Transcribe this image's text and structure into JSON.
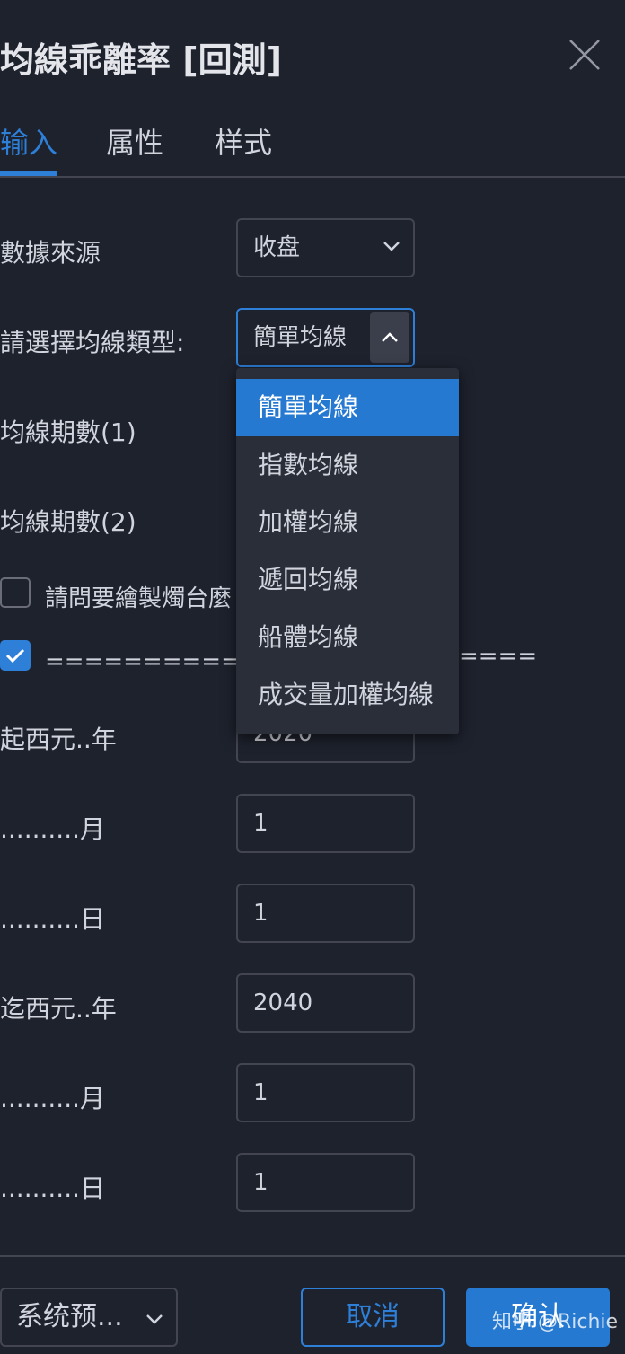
{
  "dialog": {
    "title": "均線乖離率 [回測]"
  },
  "tabs": [
    {
      "label": "输入"
    },
    {
      "label": "属性"
    },
    {
      "label": "样式"
    }
  ],
  "inputs": {
    "source_label": "數據來源",
    "source_value": "收盘",
    "ma_type_label": "請選擇均線類型:",
    "ma_type_value": "簡單均線",
    "period1_label": "均線期數(1)",
    "period2_label": "均線期數(2)",
    "draw_checkbox_label": "請問要繪製燭台麼",
    "filter_checkbox_label": "===========過濾",
    "filter_checkbox_label_tail": "====",
    "start_year_label": "起西元..年",
    "start_year_value": "2020",
    "start_month_label": "..........月",
    "start_month_value": "1",
    "start_day_label": "..........日",
    "start_day_value": "1",
    "end_year_label": "迄西元..年",
    "end_year_value": "2040",
    "end_month_label": "..........月",
    "end_month_value": "1",
    "end_day_label": "..........日",
    "end_day_value": "1"
  },
  "checkboxes": {
    "draw_checked": false,
    "filter_checked": true
  },
  "dropdown": {
    "options": [
      "簡單均線",
      "指數均線",
      "加權均線",
      "遞回均線",
      "船體均線",
      "成交量加權均線"
    ],
    "selected": "簡單均線"
  },
  "footer": {
    "defaults_label": "系统预...",
    "cancel_label": "取消",
    "ok_label": "确认"
  },
  "watermark": "知乎 @Richie",
  "colors": {
    "accent": "#2e7fd8",
    "background": "#1e222d",
    "popup": "#2a2e39",
    "border": "#434651"
  },
  "icons": {
    "close": "close-icon",
    "dropdown": "chevron-down-icon",
    "dropdown_open": "chevron-up-icon",
    "check": "check-icon"
  }
}
